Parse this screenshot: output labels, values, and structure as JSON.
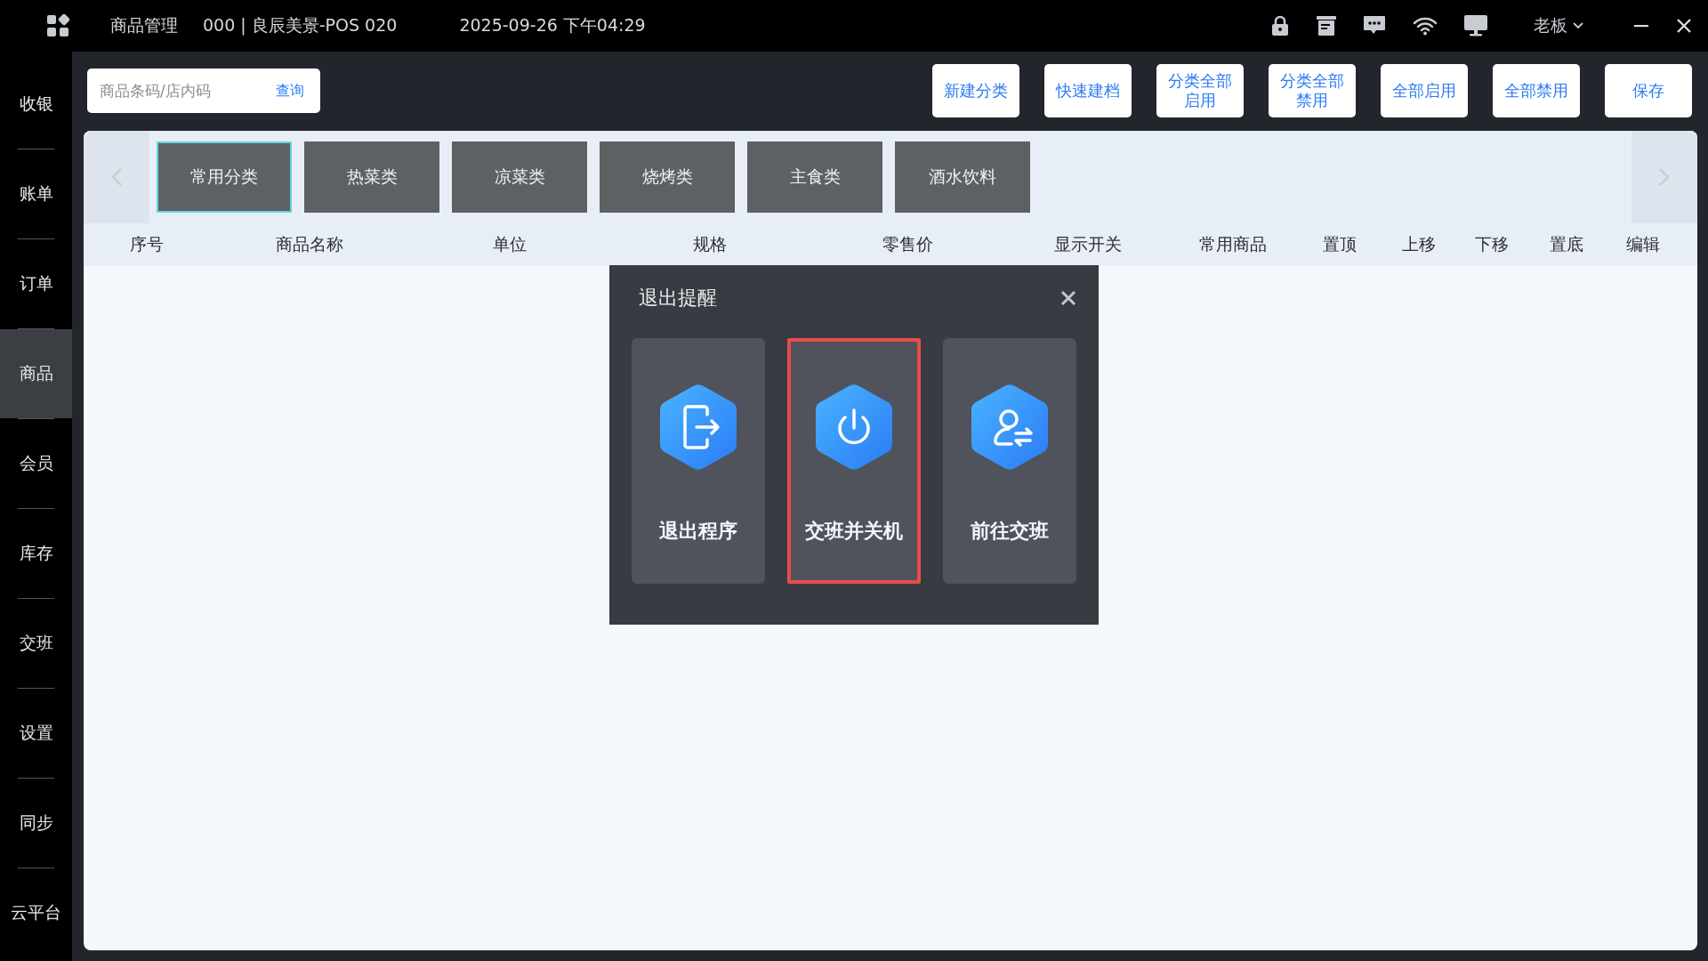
{
  "title_bar": {
    "module": "商品管理",
    "store": "000 | 良辰美景-POS 020",
    "datetime": "2025-09-26 下午04:29",
    "user": "老板"
  },
  "sidebar": {
    "items": [
      {
        "label": "收银",
        "selected": false
      },
      {
        "label": "账单",
        "selected": false
      },
      {
        "label": "订单",
        "selected": false
      },
      {
        "label": "商品",
        "selected": true
      },
      {
        "label": "会员",
        "selected": false
      },
      {
        "label": "库存",
        "selected": false
      },
      {
        "label": "交班",
        "selected": false
      },
      {
        "label": "设置",
        "selected": false
      },
      {
        "label": "同步",
        "selected": false
      },
      {
        "label": "云平台",
        "selected": false
      }
    ]
  },
  "search": {
    "placeholder": "商品条码/店内码",
    "button": "查询"
  },
  "toolbar": {
    "buttons": [
      "新建分类",
      "快速建档",
      "分类全部启用",
      "分类全部禁用",
      "全部启用",
      "全部禁用",
      "保存"
    ]
  },
  "categories": [
    {
      "label": "常用分类",
      "selected": true
    },
    {
      "label": "热菜类",
      "selected": false
    },
    {
      "label": "凉菜类",
      "selected": false
    },
    {
      "label": "烧烤类",
      "selected": false
    },
    {
      "label": "主食类",
      "selected": false
    },
    {
      "label": "酒水饮料",
      "selected": false
    }
  ],
  "table": {
    "columns": [
      "序号",
      "商品名称",
      "单位",
      "规格",
      "零售价",
      "显示开关",
      "常用商品",
      "置顶",
      "上移",
      "下移",
      "置底",
      "编辑"
    ]
  },
  "dialog": {
    "title": "退出提醒",
    "options": [
      {
        "kind": "exit",
        "label": "退出程序",
        "selected": false
      },
      {
        "kind": "power",
        "label": "交班并关机",
        "selected": true
      },
      {
        "kind": "handover",
        "label": "前往交班",
        "selected": false
      }
    ]
  }
}
